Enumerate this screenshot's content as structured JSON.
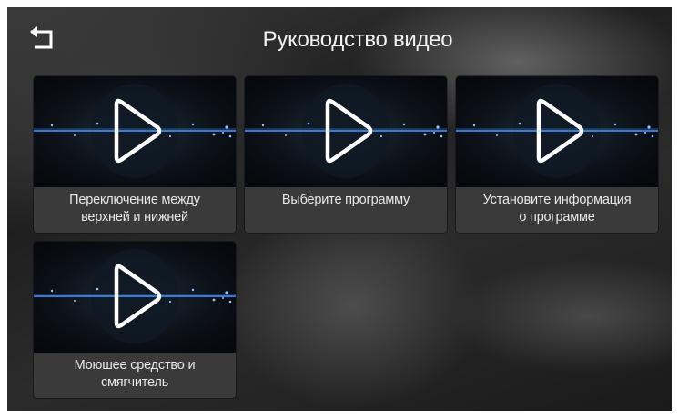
{
  "header": {
    "title": "Руководство видео",
    "back_icon": "back-arrow-icon"
  },
  "videos": [
    {
      "line1": "Переключение между",
      "line2": "верхней и нижней"
    },
    {
      "line1": "Выберите программу",
      "line2": ""
    },
    {
      "line1": "Установите информация",
      "line2": "о программе"
    },
    {
      "line1": "Моюшее средство и",
      "line2": "смягчитель"
    }
  ],
  "colors": {
    "thumbnail_line": "#3b8cff",
    "play_icon": "#ffffff"
  }
}
